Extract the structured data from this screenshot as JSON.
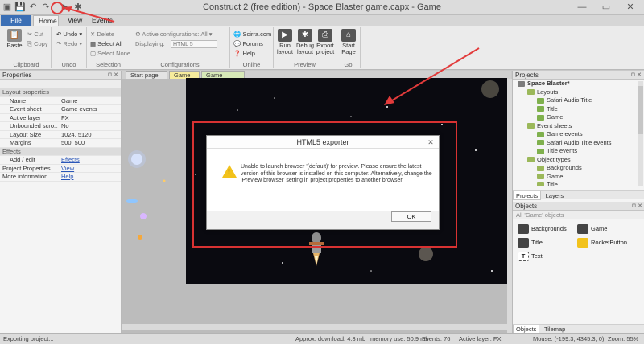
{
  "window": {
    "title": "Construct 2 (free edition) - Space Blaster game.capx - Game"
  },
  "ribbon_tabs": [
    "File",
    "Home",
    "View",
    "Events"
  ],
  "ribbon": {
    "clipboard": {
      "label": "Clipboard",
      "paste": "Paste",
      "cut": "Cut",
      "copy": "Copy"
    },
    "undo": {
      "label": "Undo",
      "undo": "Undo",
      "redo": "Redo"
    },
    "selection": {
      "label": "Selection",
      "delete": "Delete",
      "select_all": "Select All",
      "select_none": "Select None"
    },
    "configurations": {
      "label": "Configurations",
      "active": "Active configurations: All",
      "displaying_label": "Displaying:",
      "displaying_value": "HTML 5"
    },
    "online": {
      "label": "Online",
      "scirra": "Scirra.com",
      "forums": "Forums",
      "help": "Help"
    },
    "preview": {
      "label": "Preview",
      "run": "Run layout",
      "debug": "Debug layout",
      "export": "Export project"
    },
    "go": {
      "label": "Go",
      "start": "Start Page"
    }
  },
  "properties": {
    "title": "Properties",
    "rows": [
      {
        "key": "Layout properties",
        "value": "",
        "type": "cat"
      },
      {
        "key": "Name",
        "value": "Game"
      },
      {
        "key": "Event sheet",
        "value": "Game events"
      },
      {
        "key": "Active layer",
        "value": "FX"
      },
      {
        "key": "Unbounded scro...",
        "value": "No"
      },
      {
        "key": "Layout Size",
        "value": "1024, 5120"
      },
      {
        "key": "Margins",
        "value": "500, 500"
      },
      {
        "key": "Effects",
        "value": "",
        "type": "cat"
      },
      {
        "key": "Add / edit",
        "value": "Effects",
        "type": "link"
      },
      {
        "key": "Project Properties",
        "value": "View",
        "type": "link-top"
      },
      {
        "key": "More information",
        "value": "Help",
        "type": "link-top"
      }
    ]
  },
  "doc_tabs": [
    "Start page",
    "Game",
    "Game events"
  ],
  "dialog": {
    "title": "HTML5 exporter",
    "message": "Unable to launch browser '(default)' for preview.  Please ensure the latest version of this browser is installed on this computer. Alternatively, change the 'Preview browser' setting in project properties to another browser.",
    "ok": "OK"
  },
  "projects": {
    "title": "Projects",
    "tree": [
      {
        "label": "Space Blaster*",
        "level": 0,
        "icon": "proj"
      },
      {
        "label": "Layouts",
        "level": 1,
        "icon": "folder"
      },
      {
        "label": "Safari Audio Title",
        "level": 2,
        "icon": "item"
      },
      {
        "label": "Title",
        "level": 2,
        "icon": "item"
      },
      {
        "label": "Game",
        "level": 2,
        "icon": "item"
      },
      {
        "label": "Event sheets",
        "level": 1,
        "icon": "folder"
      },
      {
        "label": "Game events",
        "level": 2,
        "icon": "item"
      },
      {
        "label": "Safari Audio Title events",
        "level": 2,
        "icon": "item"
      },
      {
        "label": "Title events",
        "level": 2,
        "icon": "item"
      },
      {
        "label": "Object types",
        "level": 1,
        "icon": "folder"
      },
      {
        "label": "Backgrounds",
        "level": 2,
        "icon": "folder"
      },
      {
        "label": "Game",
        "level": 2,
        "icon": "folder"
      },
      {
        "label": "Title",
        "level": 2,
        "icon": "folder"
      }
    ],
    "tabs": [
      "Projects",
      "Layers"
    ]
  },
  "objects": {
    "title": "Objects",
    "filter": "All 'Game' objects",
    "items": [
      "Backgrounds",
      "Game",
      "Title",
      "RocketButton",
      "Text"
    ],
    "tabs": [
      "Objects",
      "Tilemap"
    ]
  },
  "status": {
    "left": "Exporting project...",
    "download": "Approx. download: 4.3 mb",
    "memory": "memory use: 50.9 mb",
    "events": "Events: 76",
    "layer": "Active layer: FX",
    "mouse": "Mouse: (-199.3, 4345.3, 0)",
    "zoom": "Zoom: 55%"
  },
  "colors": {
    "accent": "#3b6fb5",
    "annotation": "#e23b3b",
    "warning": "#f2c21b"
  }
}
